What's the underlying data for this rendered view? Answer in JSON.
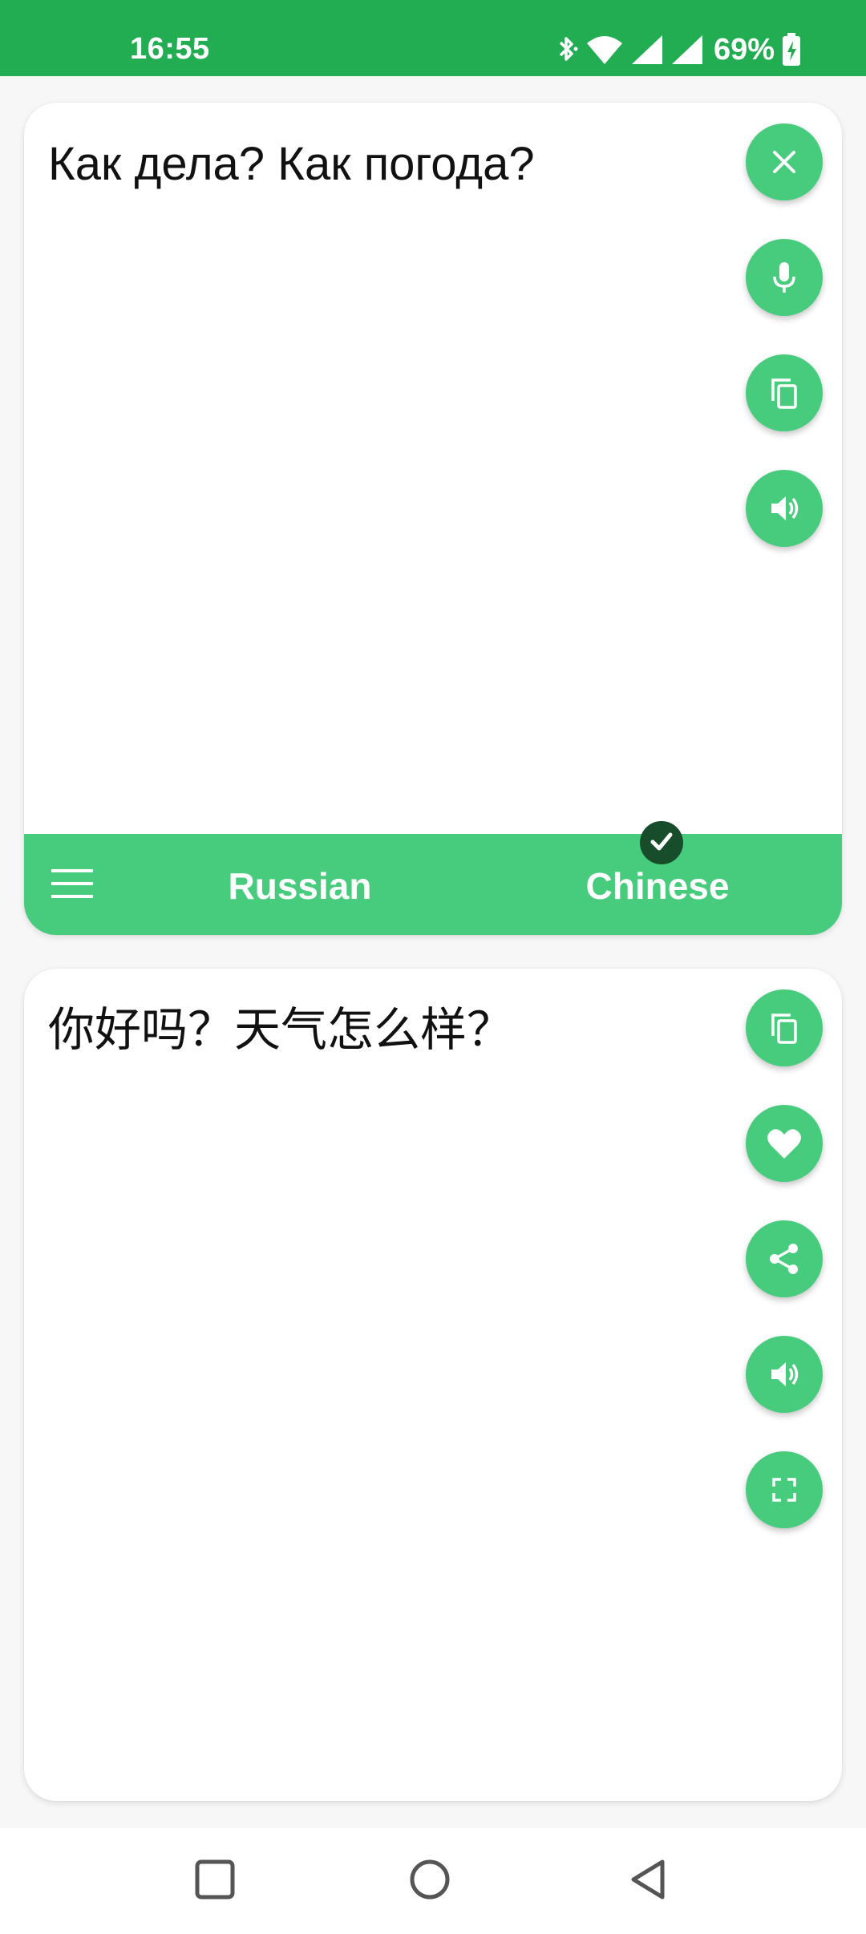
{
  "status_bar": {
    "time": "16:55",
    "battery": "69%",
    "icons": [
      "bluetooth-icon",
      "wifi-icon",
      "signal-icon",
      "signal-icon",
      "battery-charging-icon"
    ]
  },
  "source": {
    "text": "Как дела? Как погода?",
    "actions": [
      "close-icon",
      "microphone-icon",
      "copy-icon",
      "speaker-icon"
    ]
  },
  "language_bar": {
    "menu_icon": "menu-icon",
    "source_language": "Russian",
    "target_language": "Chinese",
    "selected_indicator": "check-icon"
  },
  "target": {
    "text": "你好吗？天气怎么样？",
    "actions": [
      "copy-icon",
      "heart-icon",
      "share-icon",
      "speaker-icon",
      "fullscreen-icon"
    ]
  },
  "navigation": {
    "buttons": [
      "recents-square-icon",
      "home-circle-icon",
      "back-triangle-icon"
    ]
  },
  "colors": {
    "status_bar": "#22ad52",
    "accent": "#47cc7d",
    "check_badge": "#174d2a",
    "background": "#f7f7f7"
  }
}
